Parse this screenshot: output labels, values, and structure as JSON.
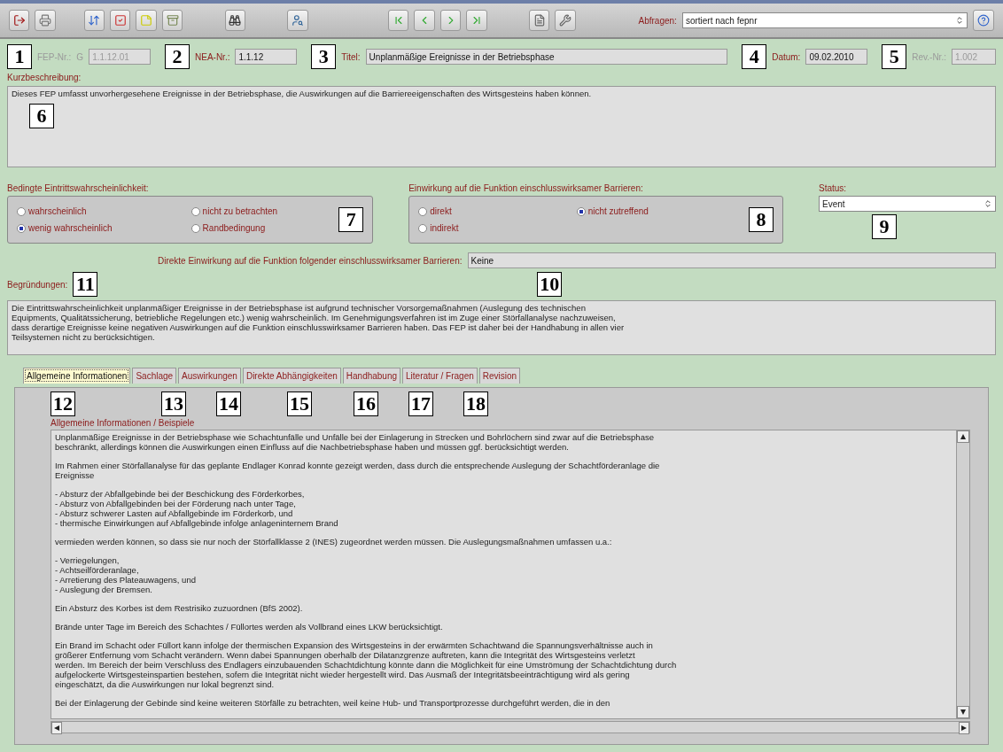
{
  "toolbar": {
    "query_label": "Abfragen:",
    "query_value": "sortiert nach fepnr"
  },
  "header_fields": [
    {
      "callout": "1",
      "label": "FEP-Nr.:",
      "prefix": "G",
      "value": "1.1.12.01",
      "disabled": true
    },
    {
      "callout": "2",
      "label": "NEA-Nr.:",
      "value": "1.1.12",
      "disabled": false
    },
    {
      "callout": "3",
      "label": "Titel:",
      "value": "Unplanmäßige Ereignisse in der Betriebsphase",
      "disabled": false
    },
    {
      "callout": "4",
      "label": "Datum:",
      "value": "09.02.2010",
      "disabled": false
    },
    {
      "callout": "5",
      "label": "Rev.-Nr.:",
      "value": "1.002",
      "disabled": true
    }
  ],
  "summary": {
    "label": "Kurzbeschreibung:",
    "text": "Dieses FEP umfasst unvorhergesehene Ereignisse in der Betriebsphase, die Auswirkungen auf die Barriereeigenschaften des Wirtsgesteins haben können.",
    "callout": "6"
  },
  "radio_groups": [
    {
      "label": "Bedingte Eintrittswahrscheinlichkeit:",
      "callout": "7",
      "options": [
        {
          "label": "wahrscheinlich",
          "selected": false
        },
        {
          "label": "wenig wahrscheinlich",
          "selected": true
        },
        {
          "label": "nicht zu betrachten",
          "selected": false
        },
        {
          "label": "Randbedingung",
          "selected": false
        }
      ]
    },
    {
      "label": "Einwirkung auf die Funktion einschlusswirksamer Barrieren:",
      "callout": "8",
      "options": [
        {
          "label": "direkt",
          "selected": false
        },
        {
          "label": "indirekt",
          "selected": false
        },
        {
          "label": "nicht zutreffend",
          "selected": true
        }
      ]
    }
  ],
  "status": {
    "label": "Status:",
    "value": "Event",
    "callout": "9"
  },
  "barrier_field": {
    "label": "Direkte Einwirkung auf die Funktion folgender einschlusswirksamer Barrieren:",
    "value": "Keine",
    "callout": "10"
  },
  "reasons": {
    "label": "Begründungen:",
    "callout": "11",
    "text": "Die Eintrittswahrscheinlichkeit unplanmäßiger Ereignisse in der Betriebsphase ist aufgrund technischer Vorsorgemaßnahmen (Auslegung des technischen\nEquipments, Qualitätssicherung, betriebliche Regelungen etc.) wenig wahrscheinlich. Im Genehmigungsverfahren ist im Zuge einer Störfallanalyse nachzuweisen,\ndass derartige Ereignisse keine negativen Auswirkungen auf die Funktion einschlusswirksamer Barrieren haben. Das FEP ist daher bei der Handhabung in allen vier\nTeilsystemen nicht zu berücksichtigen."
  },
  "tabs": [
    {
      "label": "Allgemeine Informationen",
      "selected": true,
      "callout": "12"
    },
    {
      "label": "Sachlage",
      "selected": false,
      "callout": "13"
    },
    {
      "label": "Auswirkungen",
      "selected": false,
      "callout": "14"
    },
    {
      "label": "Direkte Abhängigkeiten",
      "selected": false,
      "callout": "15"
    },
    {
      "label": "Handhabung",
      "selected": false,
      "callout": "16"
    },
    {
      "label": "Literatur / Fragen",
      "selected": false,
      "callout": "17"
    },
    {
      "label": "Revision",
      "selected": false,
      "callout": "18"
    }
  ],
  "panel": {
    "label": "Allgemeine Informationen / Beispiele",
    "paragraphs": [
      "Unplanmäßige Ereignisse in der Betriebsphase wie Schachtunfälle und Unfälle bei der Einlagerung in Strecken und Bohrlöchern sind zwar auf die Betriebsphase\nbeschränkt, allerdings können die Auswirkungen einen Einfluss auf die Nachbetriebsphase haben und müssen ggf. berücksichtigt werden.",
      "Im Rahmen einer Störfallanalyse für das geplante Endlager Konrad konnte gezeigt werden, dass durch die entsprechende Auslegung der Schachtförderanlage die\nEreignisse",
      "- Absturz der Abfallgebinde bei der Beschickung des Förderkorbes,\n- Absturz von Abfallgebinden bei der Förderung nach unter Tage,\n- Absturz schwerer Lasten auf Abfallgebinde im Förderkorb, und\n- thermische Einwirkungen auf Abfallgebinde infolge anlageninternem Brand",
      "vermieden werden können, so dass sie nur noch der Störfallklasse 2 (INES) zugeordnet werden müssen. Die Auslegungsmaßnahmen umfassen u.a.:",
      "- Verriegelungen,\n- Achtseilförderanlage,\n- Arretierung des Plateauwagens, und\n- Auslegung der Bremsen.",
      "Ein Absturz des Korbes ist dem Restrisiko zuzuordnen (BfS 2002).",
      "Brände unter Tage im Bereich des Schachtes / Füllortes werden als Vollbrand eines LKW berücksichtigt.",
      "Ein Brand im Schacht oder Füllort kann infolge der thermischen Expansion des Wirtsgesteins in der erwärmten Schachtwand die Spannungsverhältnisse auch in\ngrößerer Entfernung vom Schacht verändern. Wenn dabei Spannungen oberhalb der Dilatanzgrenze auftreten, kann die Integrität des Wirtsgesteins verletzt\nwerden. Im Bereich der beim Verschluss des Endlagers einzubauenden Schachtdichtung könnte dann die Möglichkeit für eine Umströmung der Schachtdichtung durch\naufgelockerte Wirtsgesteinspartien bestehen, sofern die Integrität nicht wieder hergestellt wird. Das Ausmaß der Integritätsbeeinträchtigung wird als gering\neingeschätzt, da die Auswirkungen nur lokal begrenzt sind.",
      "Bei der Einlagerung der Gebinde sind keine weiteren Störfälle zu betrachten, weil keine Hub- und Transportprozesse durchgeführt werden, die in den"
    ]
  }
}
